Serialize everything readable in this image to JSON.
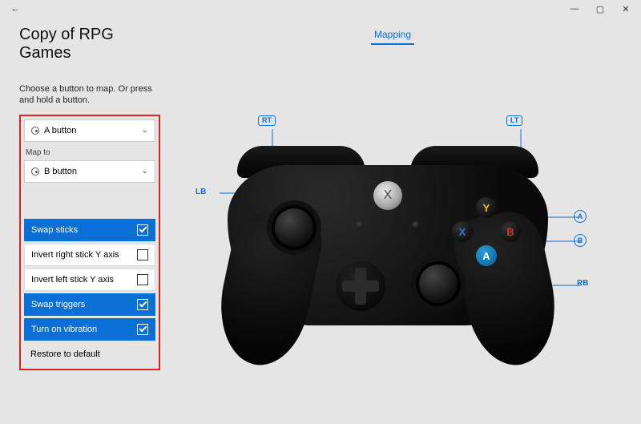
{
  "window": {
    "back_icon": "←",
    "minimize": "—",
    "maximize": "▢",
    "close": "✕"
  },
  "page": {
    "title": "Copy of RPG Games",
    "instruction": "Choose a button to map. Or press and hold a button."
  },
  "tabs": {
    "mapping": "Mapping"
  },
  "dropdowns": {
    "source": "A button",
    "mapto_label": "Map to",
    "target": "B button"
  },
  "options": [
    {
      "label": "Swap sticks",
      "checked": true
    },
    {
      "label": "Invert right stick Y axis",
      "checked": false
    },
    {
      "label": "Invert left stick Y axis",
      "checked": false
    },
    {
      "label": "Swap triggers",
      "checked": true
    },
    {
      "label": "Turn on vibration",
      "checked": true
    },
    {
      "label": "Restore to default",
      "checked": null
    }
  ],
  "controller": {
    "labels": {
      "rt": "RT",
      "lt": "LT",
      "lb": "LB",
      "rb": "RB",
      "a": "A",
      "b": "B"
    },
    "face": {
      "y": "Y",
      "x": "X",
      "a": "A",
      "b": "B"
    },
    "guide": "X"
  },
  "colors": {
    "accent": "#0b6fd8",
    "highlight_border": "#d22"
  }
}
